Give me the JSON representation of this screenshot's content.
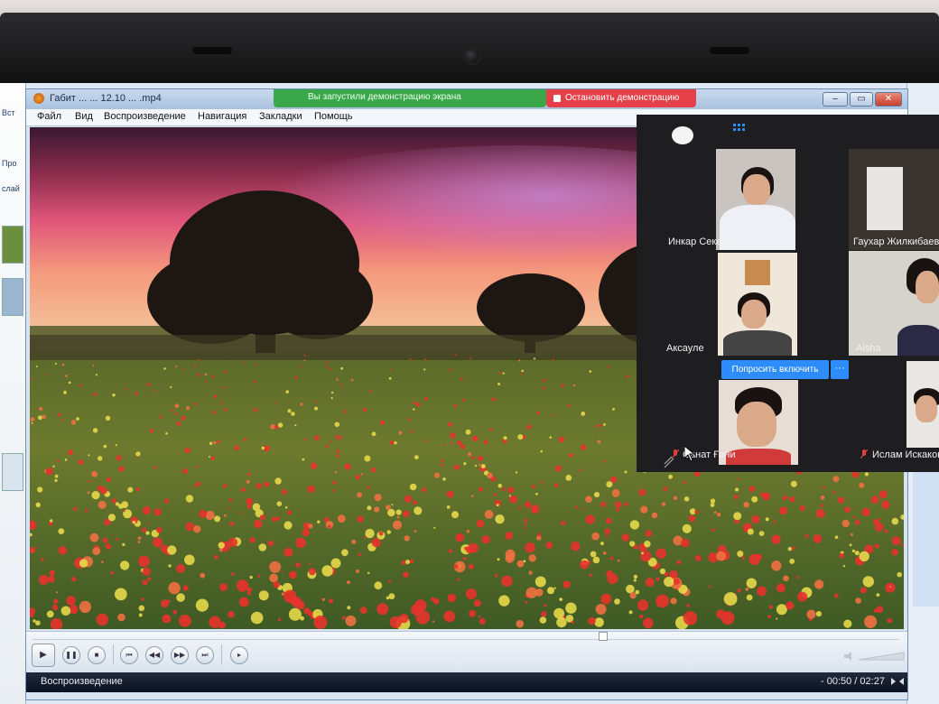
{
  "window": {
    "title": "Габит ... ... 12.10 ... .mp4",
    "controls": [
      "–",
      "▭",
      "✕"
    ]
  },
  "zoom_share": {
    "banner_text": "Вы запустили демонстрацию экрана",
    "stop_label": "Остановить демонстрацию"
  },
  "menu": {
    "items": [
      "Файл",
      "Вид",
      "Воспроизведение",
      "Навигация",
      "Закладки",
      "Помощь"
    ]
  },
  "player": {
    "status_label": "Воспроизведение",
    "time_display": "- 00:50 / 02:27",
    "elapsed": "00:50",
    "total": "02:27",
    "progress_fraction": 0.66
  },
  "participants": [
    {
      "name": "Инкар Секей",
      "muted": false
    },
    {
      "name": "Гаухар Жилкибаева",
      "muted": false
    },
    {
      "name": "Аксауле",
      "muted": false
    },
    {
      "name": "Aisha",
      "muted": false
    },
    {
      "name": "Санат Ғани",
      "muted": true
    },
    {
      "name": "Ислам Искаков",
      "muted": true
    }
  ],
  "participant_actions": {
    "ask_to_start": "Попросить включить",
    "more": "···"
  },
  "background_app": {
    "ribbon_tabs": [
      "Вст",
      "Про",
      "слай"
    ]
  },
  "colors": {
    "zoom_blue": "#2d8cff",
    "stop_red": "#e5404a",
    "share_green": "#3aa84a"
  }
}
